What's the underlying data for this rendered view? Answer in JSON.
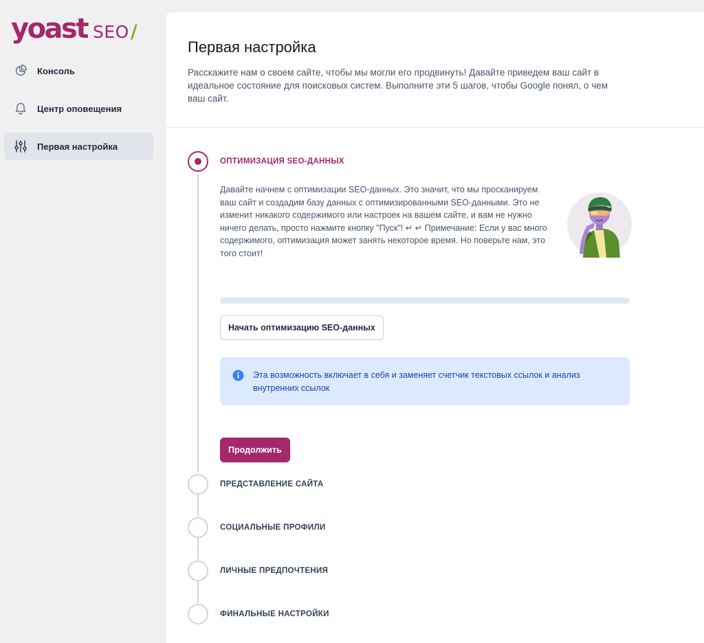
{
  "brand": {
    "word": "yoast",
    "seo": "SEO",
    "slash": "/",
    "colors": {
      "primary": "#a4286a",
      "accent": "#77b227"
    }
  },
  "sidebar": {
    "items": [
      {
        "label": "Консоль",
        "icon": "dashboard-icon",
        "active": false
      },
      {
        "label": "Центр оповещения",
        "icon": "bell-icon",
        "active": false
      },
      {
        "label": "Первая настройка",
        "icon": "adjustments-icon",
        "active": true
      }
    ]
  },
  "page": {
    "title": "Первая настройка",
    "description": "Расскажите нам о своем сайте, чтобы мы могли его продвинуть! Давайте приведем ваш сайт в идеальное состояние для поисковых систем. Выполните эти 5 шагов, чтобы Google понял, о чем ваш сайт."
  },
  "steps": [
    {
      "title": "ОПТИМИЗАЦИЯ SEO-ДАННЫХ",
      "active": true,
      "text": "Давайте начнем с оптимизации SEO-данных. Это значит, что мы просканируем ваш сайт и создадим базу данных с оптимизированными SEO-данными. Это не изменит никакого содержимого или настроек на вашем сайте, и вам не нужно ничего делать, просто нажмите кнопку \"Пуск\"! ↵ ↵ Примечание: Если у вас много содержимого, оптимизация может занять некоторое время. Но поверьте нам, это того стоит!",
      "progress": 0,
      "start_button": "Начать оптимизацию SEO-данных",
      "info": "Эта возможность включает в себя и заменяет счетчик текстовых ссылок и анализ внутренних ссылок",
      "continue_button": "Продолжить"
    },
    {
      "title": "ПРЕДСТАВЛЕНИЕ САЙТА",
      "active": false
    },
    {
      "title": "СОЦИАЛЬНЫЕ ПРОФИЛИ",
      "active": false
    },
    {
      "title": "ЛИЧНЫЕ ПРЕДПОЧТЕНИЯ",
      "active": false
    },
    {
      "title": "ФИНАЛЬНЫЕ НАСТРОЙКИ",
      "active": false
    }
  ]
}
